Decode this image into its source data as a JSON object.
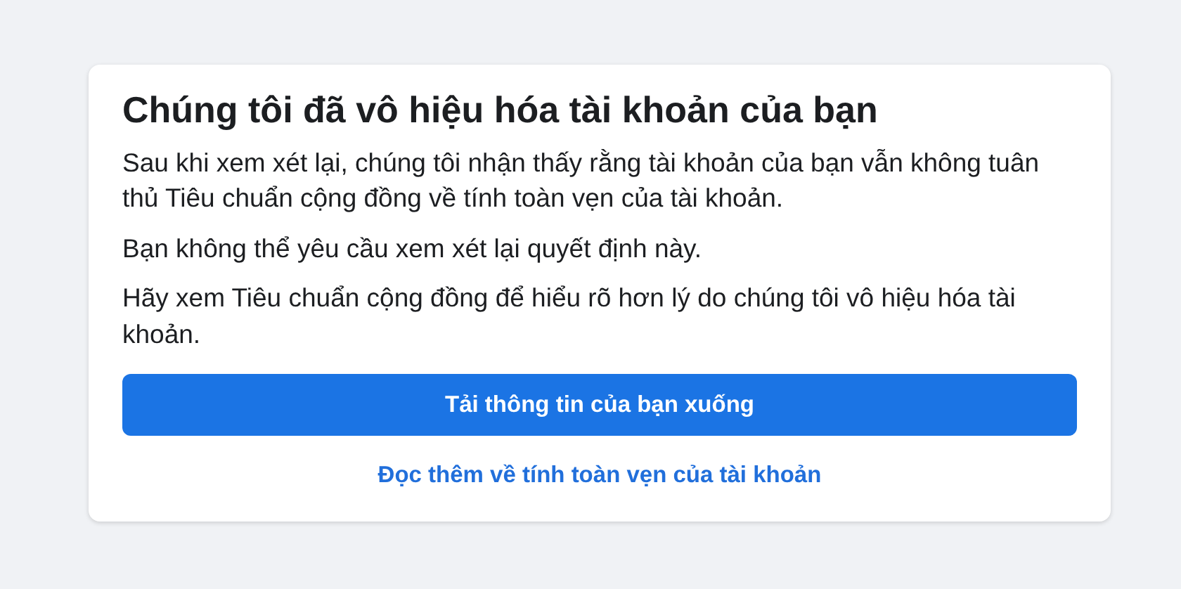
{
  "dialog": {
    "title": "Chúng tôi đã vô hiệu hóa tài khoản của bạn",
    "paragraphs": [
      "Sau khi xem xét lại, chúng tôi nhận thấy rằng tài khoản của bạn vẫn không tuân thủ Tiêu chuẩn cộng đồng về tính toàn vẹn của tài khoản.",
      "Bạn không thể yêu cầu xem xét lại quyết định này.",
      "Hãy xem Tiêu chuẩn cộng đồng để hiểu rõ hơn lý do chúng tôi vô hiệu hóa tài khoản."
    ],
    "button": "Tải thông tin của bạn xuống",
    "link": "Đọc thêm về tính toàn vẹn của tài khoản"
  }
}
